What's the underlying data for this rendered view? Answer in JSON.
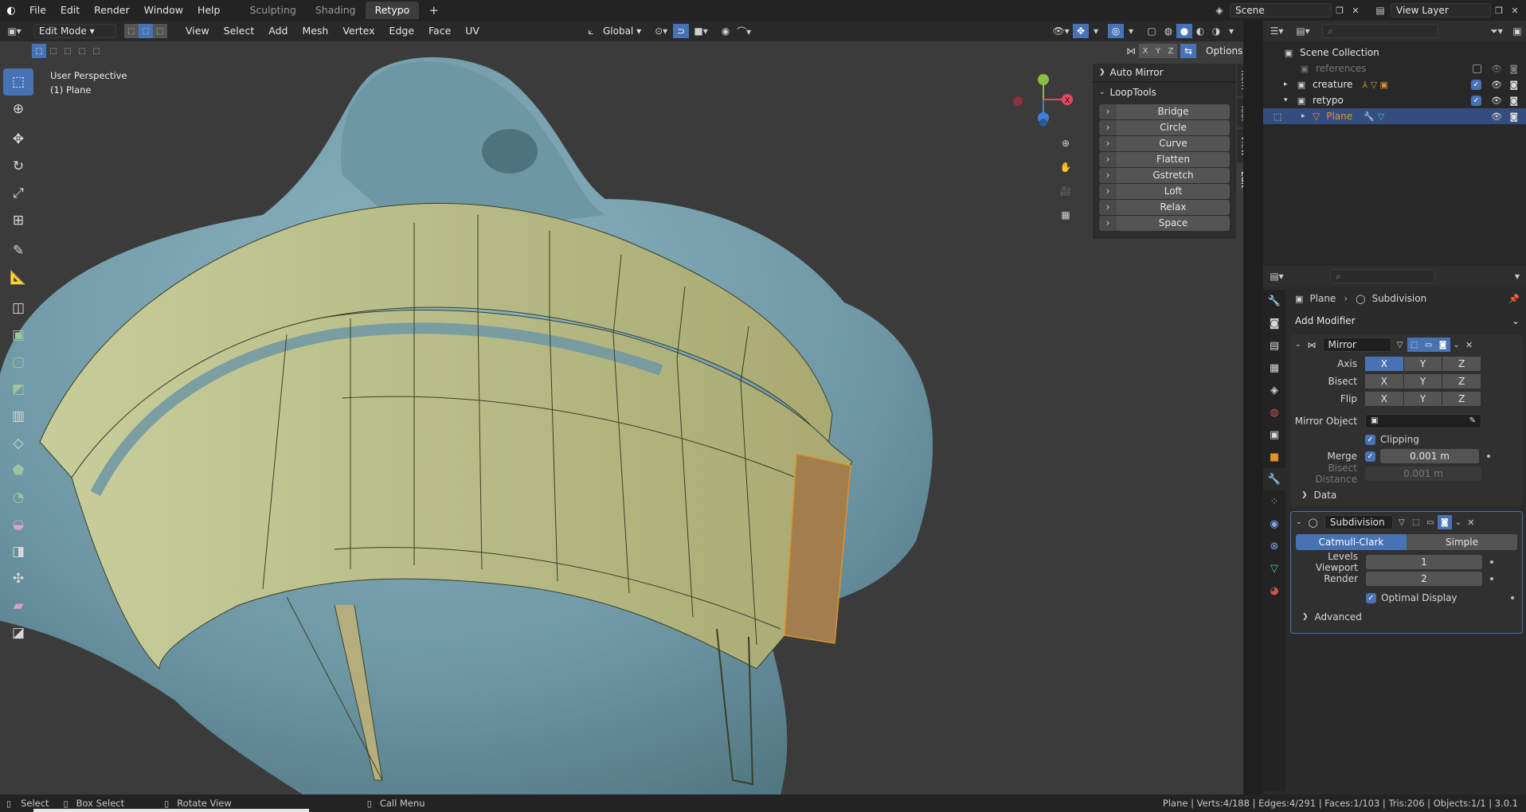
{
  "topbar": {
    "menus": [
      "File",
      "Edit",
      "Render",
      "Window",
      "Help"
    ],
    "workspace_tabs": [
      "Sculpting",
      "Shading",
      "Retypo"
    ],
    "active_tab": "Retypo",
    "add_tab": "+",
    "scene": "Scene",
    "view_layer": "View Layer"
  },
  "viewport_header": {
    "mode": "Edit Mode",
    "menus": [
      "View",
      "Select",
      "Add",
      "Mesh",
      "Vertex",
      "Edge",
      "Face",
      "UV"
    ],
    "orientation": "Global",
    "options": "Options"
  },
  "viewport": {
    "perspective": "User Perspective",
    "object": "(1) Plane",
    "gizmo_axes": [
      "X",
      "Y",
      "Z"
    ]
  },
  "sidebar": {
    "tabs": [
      "Item",
      "Tool",
      "View",
      "Edit"
    ],
    "auto_mirror": "Auto Mirror",
    "looptools": "LoopTools",
    "looptools_items": [
      "Bridge",
      "Circle",
      "Curve",
      "Flatten",
      "Gstretch",
      "Loft",
      "Relax",
      "Space"
    ]
  },
  "outliner": {
    "scene_collection": "Scene Collection",
    "items": [
      {
        "name": "references"
      },
      {
        "name": "creature"
      },
      {
        "name": "retypo"
      },
      {
        "name": "Plane"
      }
    ]
  },
  "properties": {
    "breadcrumb_obj": "Plane",
    "breadcrumb_mod": "Subdivision",
    "add_modifier": "Add Modifier",
    "mirror": {
      "name": "Mirror",
      "axis_label": "Axis",
      "bisect_label": "Bisect",
      "flip_label": "Flip",
      "x": "X",
      "y": "Y",
      "z": "Z",
      "mirror_object_label": "Mirror Object",
      "clipping": "Clipping",
      "merge_label": "Merge",
      "merge_value": "0.001 m",
      "bisect_distance_label": "Bisect Distance",
      "bisect_distance_value": "0.001 m",
      "data": "Data"
    },
    "subdivision": {
      "name": "Subdivision",
      "catmull": "Catmull-Clark",
      "simple": "Simple",
      "levels_viewport_label": "Levels Viewport",
      "levels_viewport": "1",
      "render_label": "Render",
      "render": "2",
      "optimal_display": "Optimal Display",
      "advanced": "Advanced"
    }
  },
  "statusbar": {
    "select": "Select",
    "box_select": "Box Select",
    "rotate_view": "Rotate View",
    "call_menu": "Call Menu",
    "stats": "Plane | Verts:4/188 | Edges:4/291 | Faces:1/103 | Tris:206 | Objects:1/1 | 3.0.1"
  },
  "colors": {
    "accent": "#4772b3",
    "mesh_face": "#c9cc93",
    "clay": "#6f98a5",
    "selected_face": "#e2902a"
  }
}
